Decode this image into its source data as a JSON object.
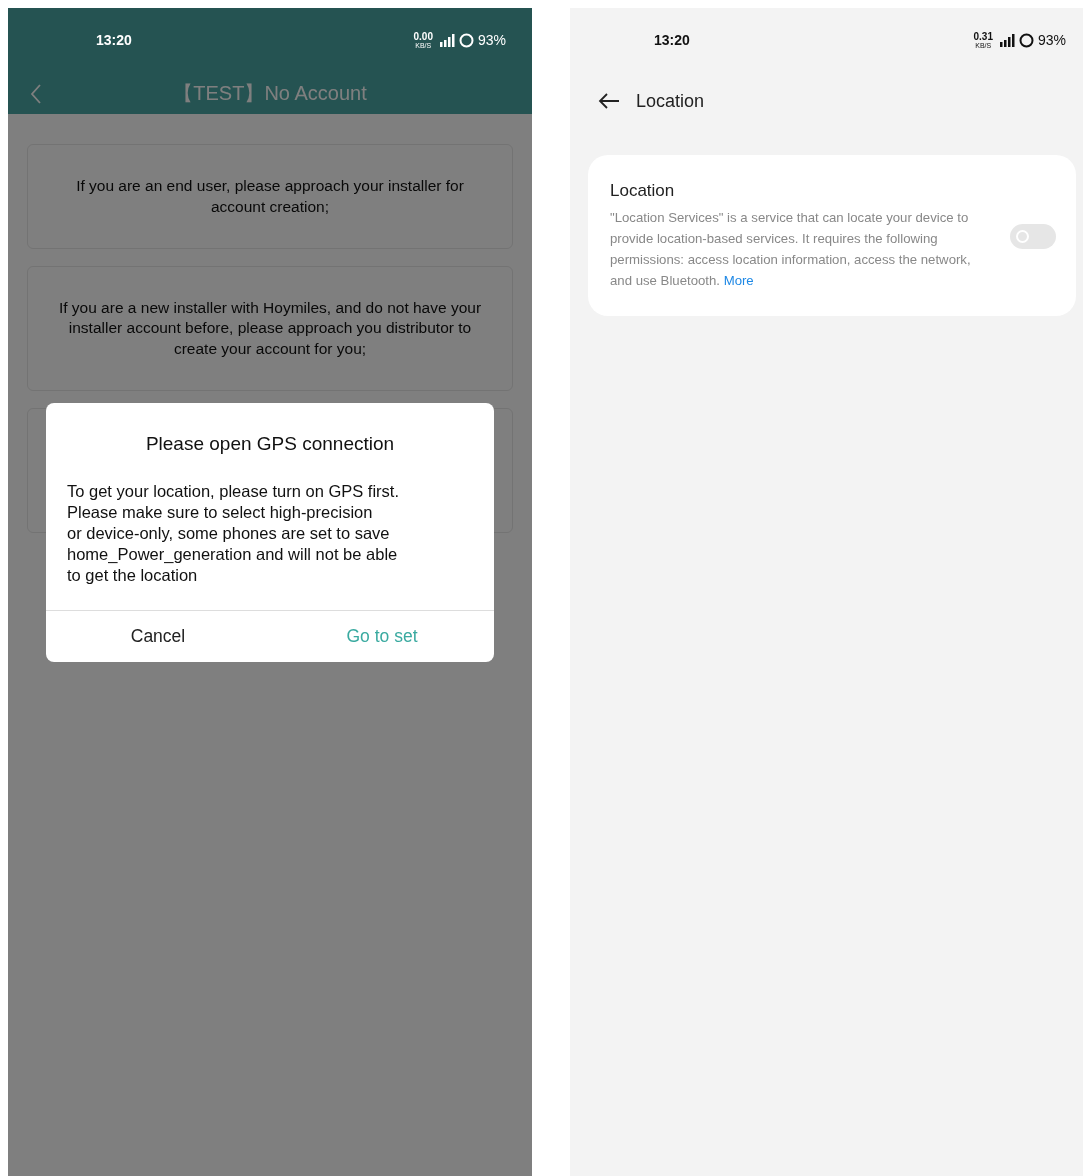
{
  "left_screen": {
    "status_bar": {
      "time": "13:20",
      "network_speed": "0.00",
      "speed_unit": "KB/S",
      "battery": "93%"
    },
    "title": "【TEST】No Account",
    "cards": [
      {
        "kind": "text",
        "text": "If you are an end user, please approach your installer for account creation;"
      },
      {
        "kind": "text",
        "text": "If you are a new installer with Hoymiles, and do not have your installer account before, please approach you distributor to create your account for you;"
      },
      {
        "kind": "covered"
      }
    ],
    "dialog": {
      "title": "Please open GPS connection",
      "message": "To get your location, please turn on GPS first.\nPlease make sure to select high-precision\nor device-only, some phones are set to save\nhome_Power_generation and will not be able\nto get the location",
      "buttons": [
        {
          "kind": "cancel",
          "label": "Cancel"
        },
        {
          "kind": "confirm",
          "label": "Go to set"
        }
      ]
    }
  },
  "right_screen": {
    "status_bar": {
      "time": "13:20",
      "network_speed": "0.31",
      "speed_unit": "KB/S",
      "battery": "93%"
    },
    "title": "Location",
    "setting": {
      "title": "Location",
      "description": "\"Location Services\" is a service that can locate your device to provide location-based services. It requires the following permissions: access location information, access the network, and use Bluetooth.",
      "link": "More",
      "on": false
    }
  }
}
